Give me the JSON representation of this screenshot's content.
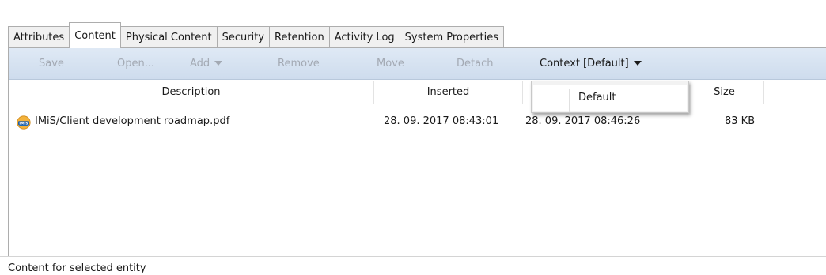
{
  "tabs": [
    {
      "label": "Attributes",
      "active": false
    },
    {
      "label": "Content",
      "active": true
    },
    {
      "label": "Physical Content",
      "active": false
    },
    {
      "label": "Security",
      "active": false
    },
    {
      "label": "Retention",
      "active": false
    },
    {
      "label": "Activity Log",
      "active": false
    },
    {
      "label": "System Properties",
      "active": false
    }
  ],
  "toolbar": {
    "save": "Save",
    "open": "Open...",
    "add": "Add",
    "remove": "Remove",
    "move": "Move",
    "detach": "Detach",
    "context": "Context [Default]"
  },
  "table": {
    "columns": [
      "Description",
      "Inserted",
      "Size"
    ],
    "rows": [
      {
        "description": "IMiS/Client development roadmap.pdf",
        "inserted": "28. 09. 2017 08:43:01",
        "modified": "28. 09. 2017 08:46:26",
        "size": "83 KB"
      }
    ]
  },
  "context_menu": {
    "items": [
      "Default"
    ]
  },
  "status_bar": {
    "text": "Content for selected entity"
  },
  "icon": {
    "file": "imis-document-icon",
    "text": "IMiS"
  }
}
